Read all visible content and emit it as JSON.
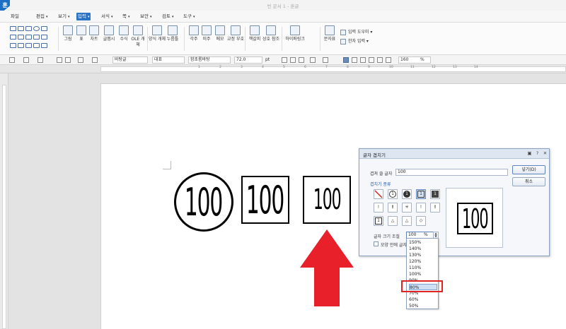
{
  "window": {
    "title": "빈 문서 1 - 훈글",
    "logo": "훈"
  },
  "menu": [
    {
      "label": "파일",
      "caret": false
    },
    {
      "label": "편집",
      "caret": true
    },
    {
      "label": "보기",
      "caret": true
    },
    {
      "label": "입력",
      "caret": true,
      "active": true
    },
    {
      "label": "서식",
      "caret": true
    },
    {
      "label": "쪽",
      "caret": true
    },
    {
      "label": "보안",
      "caret": true
    },
    {
      "label": "검토",
      "caret": true
    },
    {
      "label": "도구",
      "caret": true
    }
  ],
  "ribbon": {
    "buttons": [
      "그림",
      "표",
      "차트",
      "글맵시",
      "수식",
      "OLE 개체",
      "양식 개체",
      "누름틀",
      "각주",
      "미주",
      "메모",
      "교정 부호",
      "책갈피",
      "상호 참조",
      "하이퍼링크",
      "문자표"
    ],
    "input_tools": "입력 도우미",
    "hanja_input": "한자 입력"
  },
  "format_bar": {
    "style": "바탕글",
    "lang": "대표",
    "font": "함초롬바탕",
    "size": "72.0",
    "size_unit": "pt",
    "zoom": "160",
    "zoom_unit": "%"
  },
  "ruler_numbers": [
    "1",
    "2",
    "3",
    "4",
    "5",
    "6",
    "7",
    "8",
    "9",
    "10",
    "11",
    "12",
    "13",
    "14"
  ],
  "document": {
    "glyphs": [
      "100",
      "100",
      "100"
    ]
  },
  "dialog": {
    "title": "글자 겹치기",
    "overlap_label": "겹쳐 쓸 글자",
    "overlap_value": "100",
    "type_label": "겹치기 종류",
    "size_label": "글자 크기 조절",
    "size_value": "100",
    "size_unit": "%",
    "inner_label": "모양 안에 글자",
    "insert_button": "넣기(D)",
    "cancel_button": "취소",
    "preview_text": "100",
    "type_options": [
      "",
      "1",
      "1",
      "1",
      "1",
      "!",
      "!",
      "",
      "!",
      "!",
      "1",
      "",
      "",
      ""
    ],
    "size_options": [
      "150%",
      "140%",
      "130%",
      "120%",
      "110%",
      "100%",
      "90%",
      "80%",
      "70%",
      "60%",
      "50%"
    ],
    "selected_size": "80%"
  },
  "colors": {
    "accent": "#2a73c9",
    "highlight": "#e02424",
    "arrow": "#e8202a"
  }
}
